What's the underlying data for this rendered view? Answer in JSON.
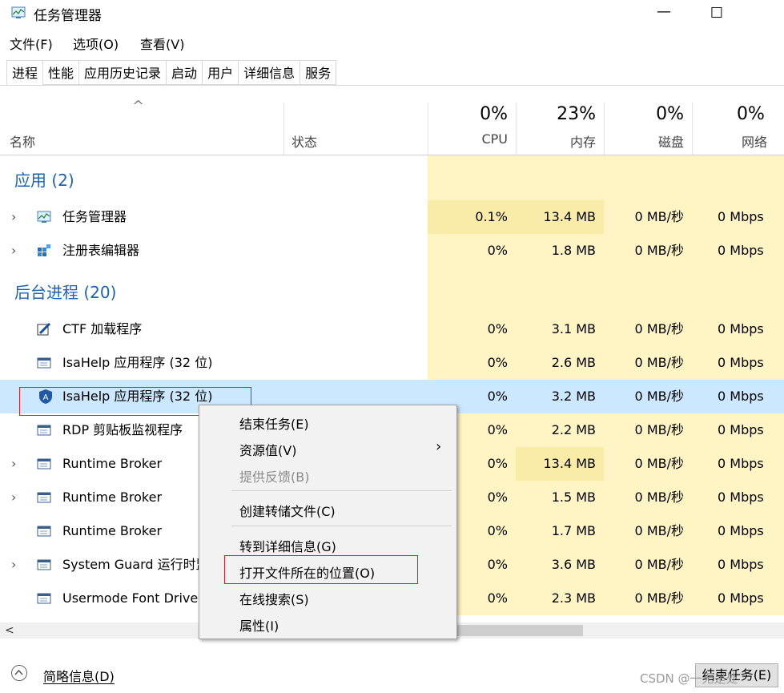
{
  "window": {
    "title": "任务管理器",
    "minimize": "—",
    "maximize": "☐"
  },
  "menu": [
    "文件(F)",
    "选项(O)",
    "查看(V)"
  ],
  "tabs": [
    "进程",
    "性能",
    "应用历史记录",
    "启动",
    "用户",
    "详细信息",
    "服务"
  ],
  "header": {
    "sort_indicator": "^",
    "name": "名称",
    "status": "状态",
    "cpu_pct": "0%",
    "cpu": "CPU",
    "mem_pct": "23%",
    "mem": "内存",
    "disk_pct": "0%",
    "disk": "磁盘",
    "net_pct": "0%",
    "net": "网络"
  },
  "groups": {
    "apps": "应用 (2)",
    "background": "后台进程 (20)"
  },
  "rows": [
    {
      "name": "任务管理器",
      "cpu": "0.1%",
      "mem": "13.4 MB",
      "disk": "0 MB/秒",
      "net": "0 Mbps"
    },
    {
      "name": "注册表编辑器",
      "cpu": "0%",
      "mem": "1.8 MB",
      "disk": "0 MB/秒",
      "net": "0 Mbps"
    },
    {
      "name": "CTF 加载程序",
      "cpu": "0%",
      "mem": "3.1 MB",
      "disk": "0 MB/秒",
      "net": "0 Mbps"
    },
    {
      "name": "IsaHelp 应用程序 (32 位)",
      "cpu": "0%",
      "mem": "2.6 MB",
      "disk": "0 MB/秒",
      "net": "0 Mbps"
    },
    {
      "name": "IsaHelp 应用程序 (32 位)",
      "cpu": "0%",
      "mem": "3.2 MB",
      "disk": "0 MB/秒",
      "net": "0 Mbps"
    },
    {
      "name": "RDP 剪贴板监视程序",
      "cpu": "0%",
      "mem": "2.2 MB",
      "disk": "0 MB/秒",
      "net": "0 Mbps"
    },
    {
      "name": "Runtime Broker",
      "cpu": "0%",
      "mem": "13.4 MB",
      "disk": "0 MB/秒",
      "net": "0 Mbps"
    },
    {
      "name": "Runtime Broker",
      "cpu": "0%",
      "mem": "1.5 MB",
      "disk": "0 MB/秒",
      "net": "0 Mbps"
    },
    {
      "name": "Runtime Broker",
      "cpu": "0%",
      "mem": "1.7 MB",
      "disk": "0 MB/秒",
      "net": "0 Mbps"
    },
    {
      "name": "System Guard 运行时监视器代理",
      "cpu": "0%",
      "mem": "3.6 MB",
      "disk": "0 MB/秒",
      "net": "0 Mbps"
    },
    {
      "name": "Usermode Font Driver Host",
      "cpu": "0%",
      "mem": "2.3 MB",
      "disk": "0 MB/秒",
      "net": "0 Mbps"
    }
  ],
  "row_chevron": "›",
  "context_menu": {
    "end_task": "结束任务(E)",
    "resource_values": "资源值(V)",
    "submenu_arrow": "›",
    "feedback": "提供反馈(B)",
    "create_dump": "创建转储文件(C)",
    "go_details": "转到详细信息(G)",
    "open_location": "打开文件所在的位置(O)",
    "search_online": "在线搜索(S)",
    "properties": "属性(I)"
  },
  "scroll_left": "<",
  "footer": {
    "brief": "简略信息(D)",
    "end_task": "结束任务(E)",
    "watermark": "CSDN @一无是处"
  },
  "colors": {
    "group_blue": "#1a63b8",
    "highlight_red": "#e02020",
    "selected_row": "#cce8ff",
    "cell_yellow": "#fff4c4"
  }
}
